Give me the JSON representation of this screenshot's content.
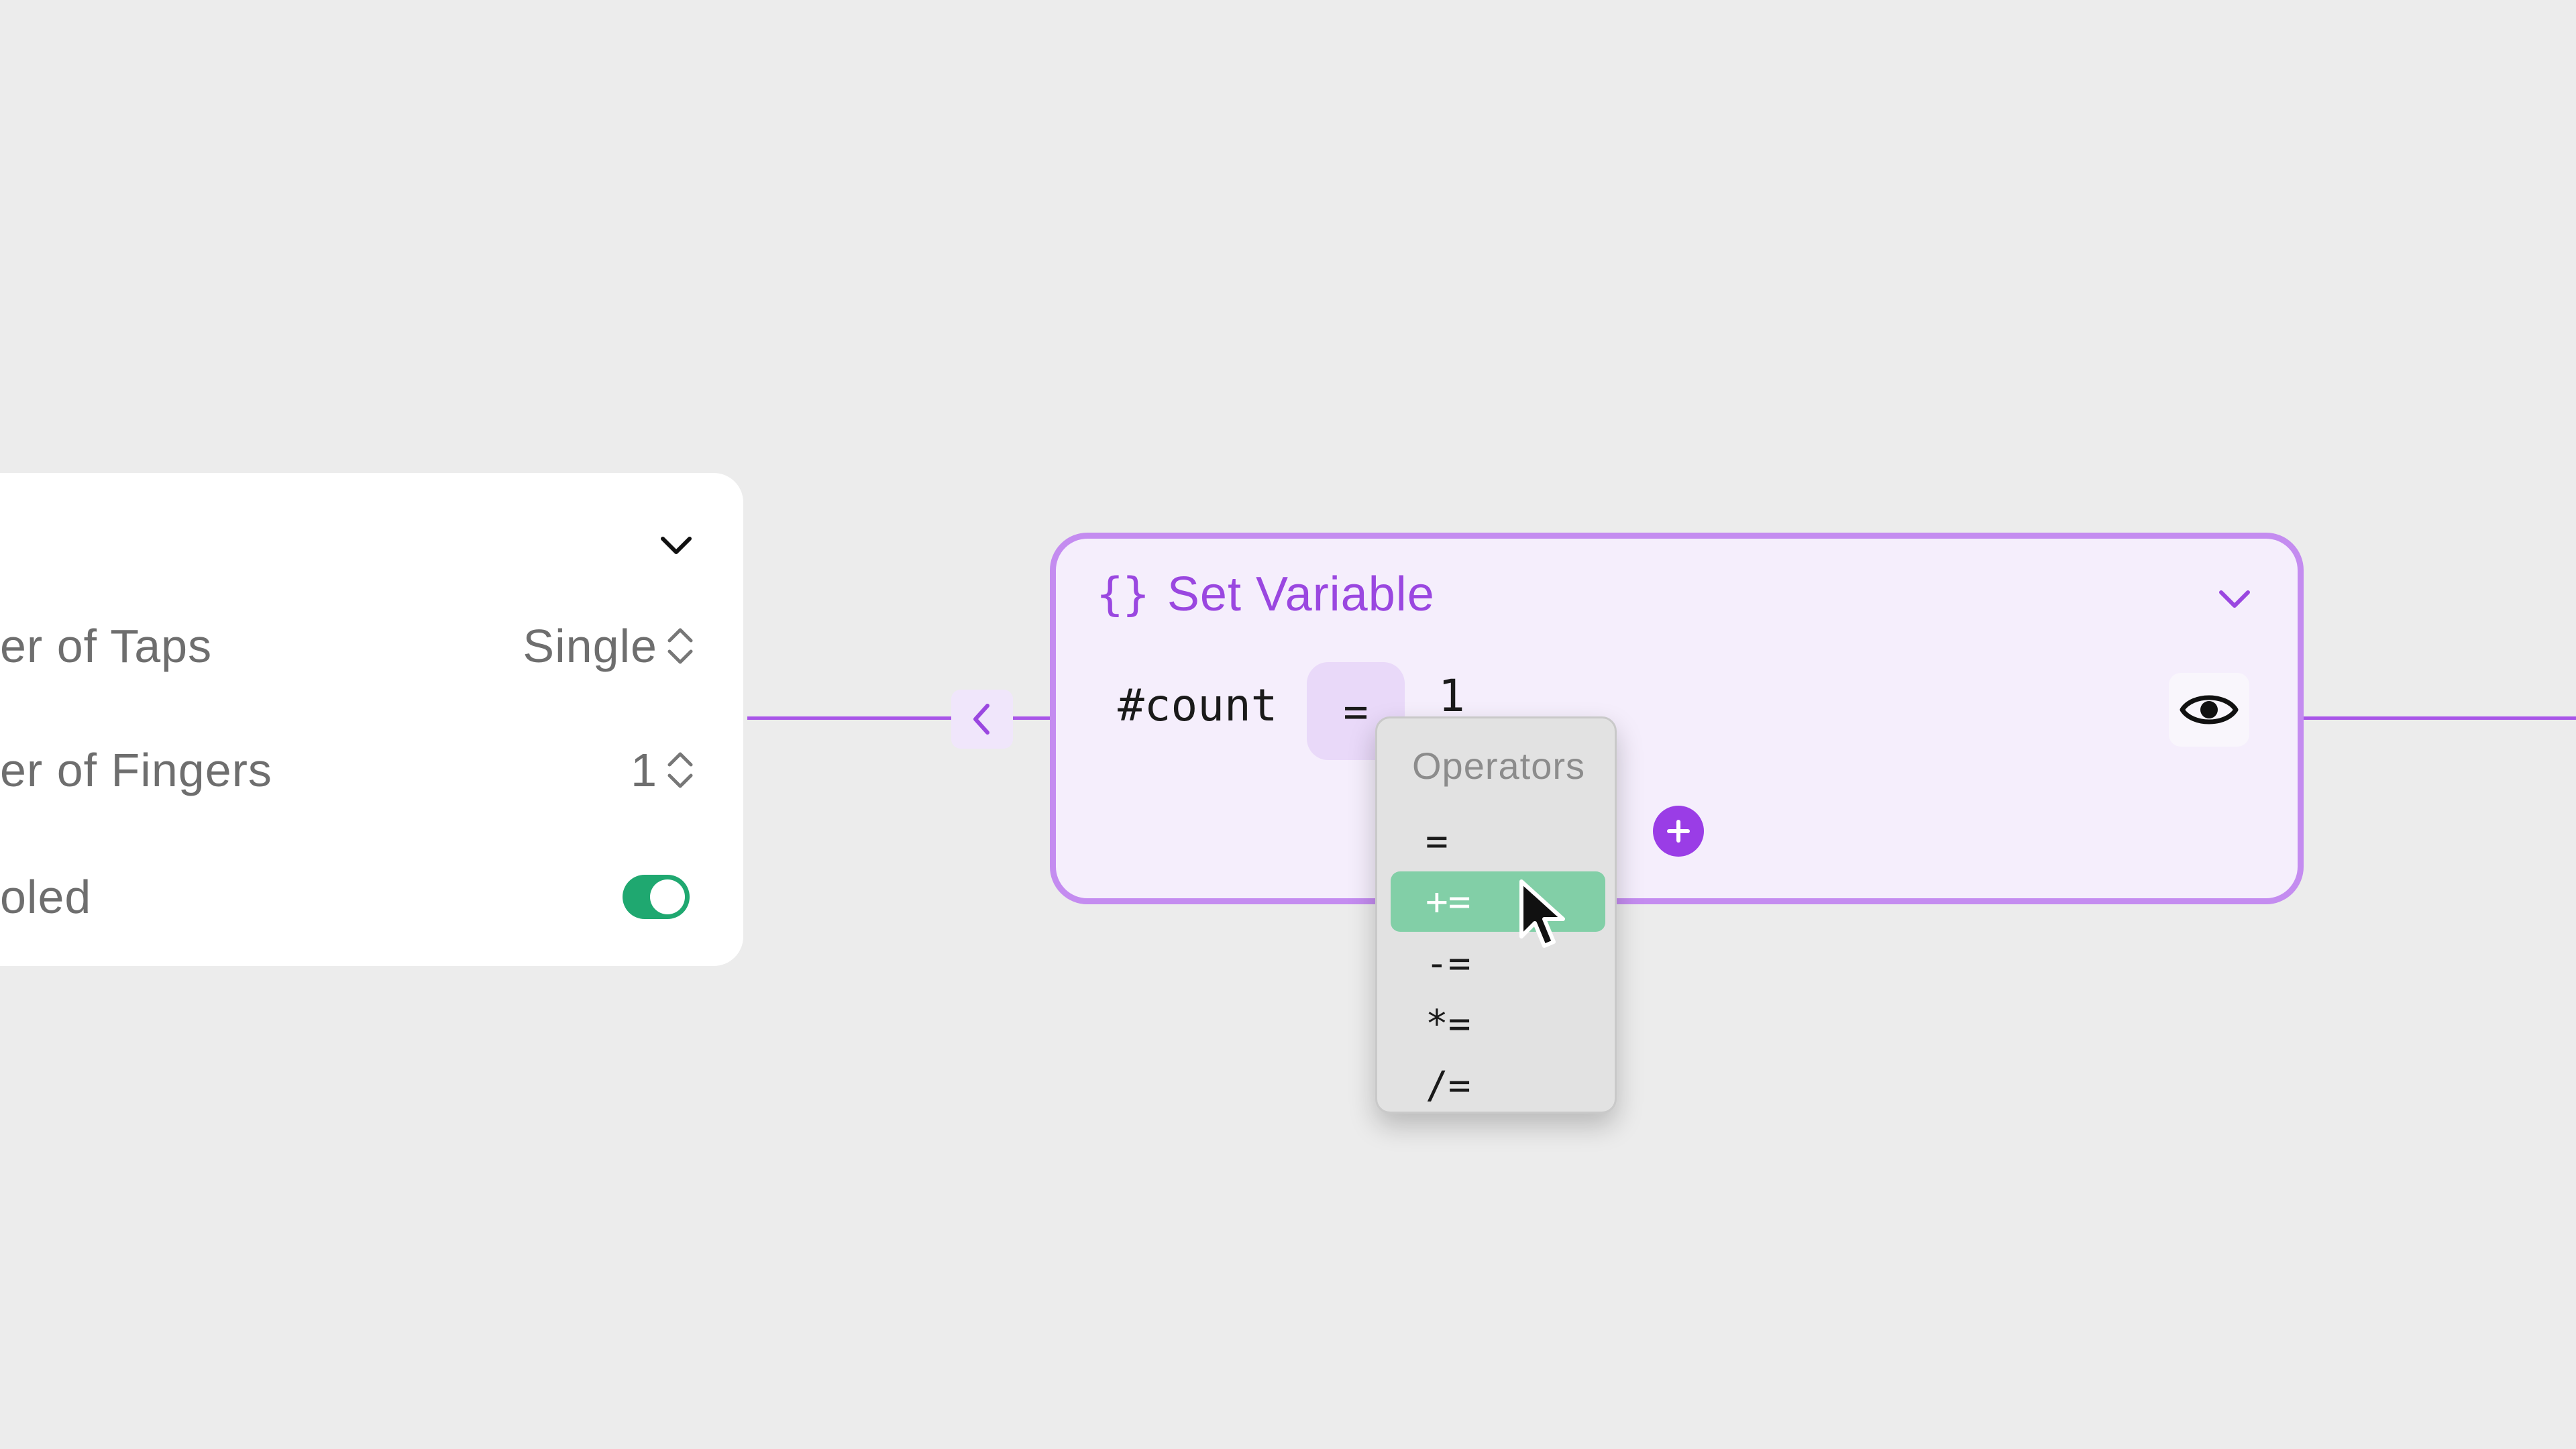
{
  "gesture_card": {
    "rows": [
      {
        "label": "er of Taps",
        "value": "Single"
      },
      {
        "label": "er of Fingers",
        "value": "1"
      },
      {
        "label": "oled",
        "toggle_on": true
      }
    ]
  },
  "set_variable": {
    "title": "Set Variable",
    "variable": "#count",
    "operator": "=",
    "value": "1"
  },
  "operator_menu": {
    "header": "Operators",
    "items": [
      "=",
      "+=",
      "-=",
      "*=",
      "/="
    ],
    "selected": "+="
  },
  "colors": {
    "accent": "#9a47e0",
    "node_border": "#c48cf0",
    "node_fill": "#f5eefc",
    "wire": "#a855e8",
    "toggle_on": "#1fa870",
    "menu_highlight": "#82cfa7"
  }
}
